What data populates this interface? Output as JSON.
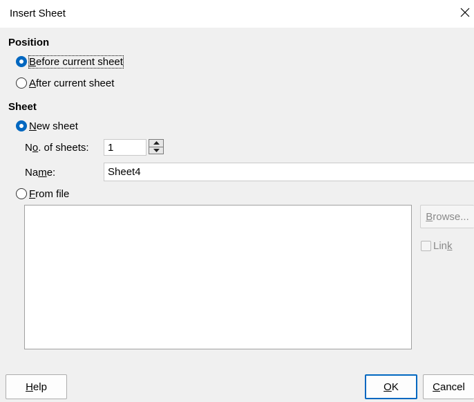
{
  "window": {
    "title": "Insert Sheet",
    "close_glyph": "✕"
  },
  "position": {
    "heading": "Position",
    "before": {
      "access_key": "B",
      "rest": "efore current sheet",
      "checked": true
    },
    "after": {
      "access_key": "A",
      "rest": "fter current sheet",
      "checked": false
    }
  },
  "sheet": {
    "heading": "Sheet",
    "new_sheet": {
      "access_key": "N",
      "rest": "ew sheet",
      "checked": true
    },
    "count": {
      "label_pre": "N",
      "access_key": "o",
      "label_post": ". of sheets:",
      "value": "1"
    },
    "name": {
      "label_pre": "Na",
      "access_key": "m",
      "label_post": "e:",
      "value": "Sheet4"
    },
    "from_file": {
      "access_key": "F",
      "rest": "rom file",
      "checked": false
    },
    "browse": {
      "access_key": "B",
      "rest": "rowse...",
      "enabled": false
    },
    "link": {
      "pre": "Lin",
      "access_key": "k",
      "checked": false,
      "enabled": false
    }
  },
  "footer": {
    "help": {
      "access_key": "H",
      "rest": "elp"
    },
    "ok": {
      "access_key": "O",
      "rest": "K"
    },
    "cancel": {
      "access_key": "C",
      "rest": "ancel"
    }
  },
  "colors": {
    "accent": "#0067c0",
    "dialog_bg": "#f0f0f0",
    "disabled_text": "#8a8a8a"
  },
  "icons": {
    "close": "close-icon",
    "spin_up": "chevron-up-icon",
    "spin_down": "chevron-down-icon"
  }
}
